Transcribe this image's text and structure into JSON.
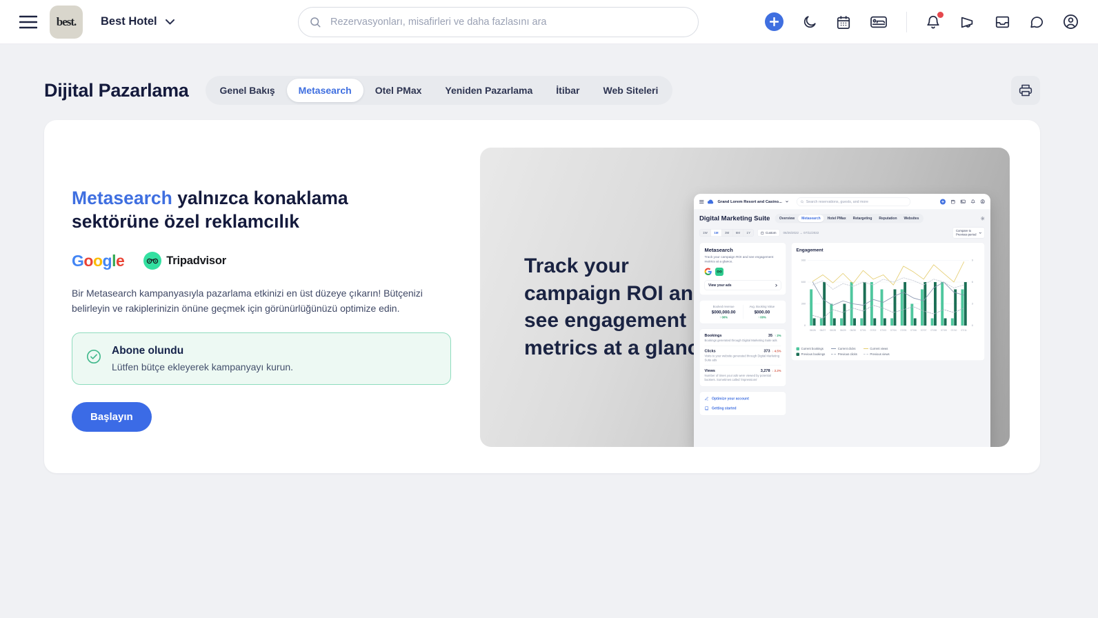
{
  "colors": {
    "accent_blue": "#3f6fe0",
    "success_green": "#23a069",
    "danger_red": "#d6604f",
    "tripadvisor_green": "#34e0a1",
    "notification_red": "#e5484d"
  },
  "topbar": {
    "brand": "best.",
    "hotel_name": "Best Hotel",
    "search_placeholder": "Rezervasyonları, misafirleri ve daha fazlasını ara",
    "icons": [
      "hamburger",
      "plus",
      "moon",
      "calendar",
      "bed",
      "bell",
      "megaphone",
      "inbox",
      "chat",
      "account"
    ]
  },
  "header": {
    "title": "Dijital Pazarlama",
    "tabs": [
      {
        "label": "Genel Bakış"
      },
      {
        "label": "Metasearch"
      },
      {
        "label": "Otel PMax"
      },
      {
        "label": "Yeniden Pazarlama"
      },
      {
        "label": "İtibar"
      },
      {
        "label": "Web Siteleri"
      }
    ],
    "active_tab": "Metasearch"
  },
  "content": {
    "heading_highlight": "Metasearch",
    "heading_line1_rest": " yalnızca konaklama",
    "heading_line2": "sektörüne özel reklamcılık",
    "google_letters": {
      "l1": "G",
      "l2": "o",
      "l3": "o",
      "l4": "g",
      "l5": "l",
      "l6": "e"
    },
    "tripadvisor_label": "Tripadvisor",
    "description": "Bir Metasearch kampanyasıyla pazarlama etkinizi en üst düzeye çıkarın! Bütçenizi belirleyin ve rakiplerinizin önüne geçmek için görünürlüğünüzü optimize edin.",
    "status": {
      "title": "Abone olundu",
      "subtitle": "Lütfen bütçe ekleyerek kampanyayı kurun."
    },
    "cta_label": "Başlayın"
  },
  "promo": {
    "caption_lines": [
      "Track your",
      "campaign ROI and",
      "see engagement",
      "metrics at a glance"
    ],
    "mini": {
      "property_name": "Grand Lorem Resort and Casino...",
      "search_placeholder": "Search reservations, guests, and more",
      "title": "Digital Marketing Suite",
      "tabs": [
        {
          "label": "Overview"
        },
        {
          "label": "Metasearch"
        },
        {
          "label": "Hotel PMax"
        },
        {
          "label": "Retargeting"
        },
        {
          "label": "Reputation"
        },
        {
          "label": "Websites"
        }
      ],
      "active_tab": "Metasearch",
      "ranges": {
        "r1": "1W",
        "r2": "1M",
        "r3": "3M",
        "r4": "6M",
        "r5": "1Y"
      },
      "custom_label": "Custom",
      "date_range": "06/26/2022 → 07/11/2022",
      "compare_line1": "Compare to",
      "compare_line2": "Previous period",
      "metasearch_card": {
        "title": "Metasearch",
        "description": "Track your campaign ROI and see engagement metrics at a glance.",
        "button_label": "View your ads"
      },
      "revenue": {
        "label": "Booked revenue",
        "value": "$000,000.00",
        "delta": "↑ 00%"
      },
      "avg_booking": {
        "label": "Avg. Booking Value",
        "value": "$000.00",
        "delta": "↑ 00%"
      },
      "stats": [
        {
          "label": "Bookings",
          "value": "35",
          "delta": "↑ 2%",
          "description": "Bookings generated through Digital Marketing Suite ads"
        },
        {
          "label": "Clicks",
          "value": "373",
          "delta": "↓ 4.5%",
          "description": "Visits to your website generated through Digital Marketing Suite ads"
        },
        {
          "label": "Views",
          "value": "3,278",
          "delta": "↓ 2.2%",
          "description": "Number of times your ads were viewed by potential bookers. Sometimes called 'impressions'"
        }
      ],
      "links": [
        {
          "label": "Optimize your account"
        },
        {
          "label": "Getting started"
        }
      ],
      "engagement_title": "Engagement"
    }
  },
  "chart_data": {
    "type": "bar",
    "title": "Engagement",
    "x": [
      "06/26",
      "06/27",
      "06/28",
      "06/29",
      "06/30",
      "07/01",
      "07/02",
      "07/03",
      "07/04",
      "07/05",
      "07/06",
      "07/07",
      "07/08",
      "07/09",
      "07/10",
      "07/11"
    ],
    "ylim": [
      0,
      900
    ],
    "bar_ylim": [
      0,
      9
    ],
    "yticks_left": [
      0,
      300,
      600,
      900
    ],
    "yticks_right": [
      0,
      3,
      6,
      9
    ],
    "legend_order": [
      0,
      2,
      4,
      1,
      3,
      5
    ],
    "series": [
      {
        "name": "Current bookings",
        "type": "bar",
        "color": "#4fc79e",
        "values": [
          5,
          1,
          3,
          1,
          6,
          1,
          6,
          5,
          1,
          5,
          3,
          5,
          1,
          6,
          1,
          5
        ]
      },
      {
        "name": "Previous bookings",
        "type": "bar",
        "color": "#1b6f55",
        "values": [
          1,
          6,
          1,
          3,
          1,
          6,
          1,
          1,
          5,
          6,
          1,
          6,
          6,
          1,
          5,
          6
        ]
      },
      {
        "name": "Current clicks",
        "type": "line",
        "color": "#8593ad",
        "dash": false,
        "values": [
          600,
          360,
          280,
          340,
          300,
          280,
          360,
          320,
          400,
          460,
          380,
          340,
          520,
          600,
          460,
          420
        ]
      },
      {
        "name": "Previous clicks",
        "type": "line",
        "color": "#a9b0bf",
        "dash": true,
        "values": [
          140,
          100,
          220,
          180,
          240,
          200,
          280,
          240,
          180,
          220,
          260,
          200,
          160,
          220,
          180,
          240
        ]
      },
      {
        "name": "Current views",
        "type": "line",
        "color": "#e5cd6f",
        "dash": false,
        "values": [
          610,
          700,
          590,
          720,
          580,
          760,
          640,
          700,
          560,
          820,
          740,
          640,
          840,
          720,
          600,
          880
        ]
      },
      {
        "name": "Previous views",
        "type": "line",
        "color": "#c5cad4",
        "dash": true,
        "values": [
          560,
          620,
          500,
          580,
          540,
          600,
          560,
          640,
          600,
          660,
          620,
          560,
          640,
          600,
          520,
          560
        ]
      }
    ]
  }
}
